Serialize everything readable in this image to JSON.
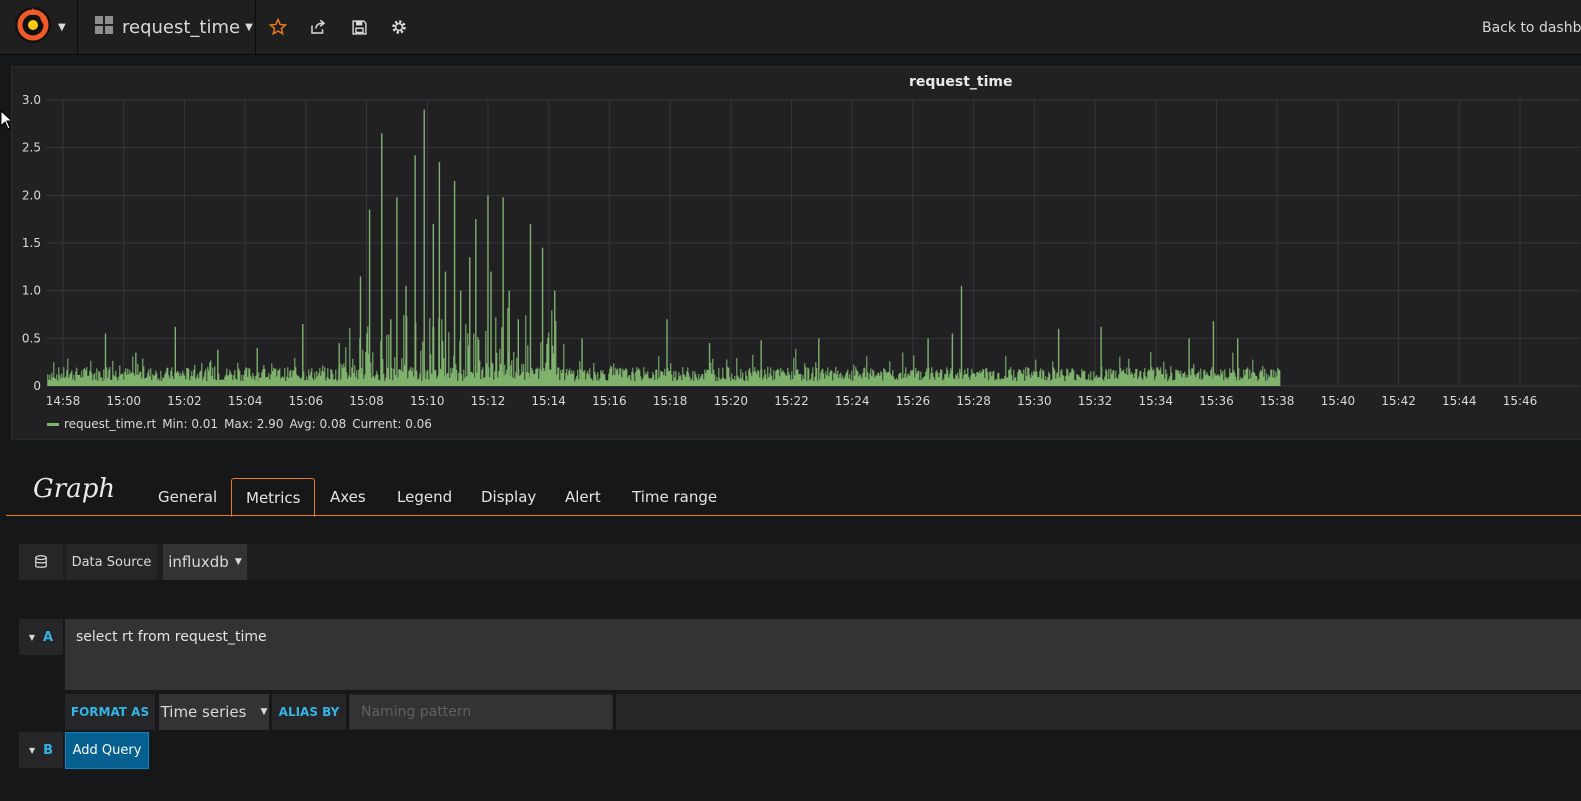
{
  "navbar": {
    "dashboard_title": "request_time",
    "back_label": "Back to dashb"
  },
  "panel": {
    "title": "request_time"
  },
  "chart_data": {
    "type": "bar",
    "title": "request_time",
    "y_ticks": [
      "3.0",
      "2.5",
      "2.0",
      "1.5",
      "1.0",
      "0.5",
      "0"
    ],
    "ylim": [
      0,
      3.0
    ],
    "x_ticks": [
      "14:58",
      "15:00",
      "15:02",
      "15:04",
      "15:06",
      "15:08",
      "15:10",
      "15:12",
      "15:14",
      "15:16",
      "15:18",
      "15:20",
      "15:22",
      "15:24",
      "15:26",
      "15:28",
      "15:30",
      "15:32",
      "15:34",
      "15:36",
      "15:38",
      "15:40",
      "15:42",
      "15:44",
      "15:46"
    ],
    "series": [
      {
        "name": "request_time.rt",
        "color": "#7eb26d",
        "start": "14:57.5",
        "end": "15:38.1",
        "baseline_range": [
          0.05,
          0.2
        ],
        "spikes": [
          [
            "14:59.4",
            0.55
          ],
          [
            "15:00.4",
            0.35
          ],
          [
            "15:01.7",
            0.62
          ],
          [
            "15:03.1",
            0.38
          ],
          [
            "15:04.4",
            0.4
          ],
          [
            "15:05.9",
            0.65
          ],
          [
            "15:07.1",
            0.45
          ],
          [
            "15:07.8",
            1.15
          ],
          [
            "15:08.1",
            1.85
          ],
          [
            "15:08.5",
            1.0
          ],
          [
            "15:08.5",
            2.65
          ],
          [
            "15:08.8",
            0.7
          ],
          [
            "15:09.0",
            1.98
          ],
          [
            "15:09.3",
            1.05
          ],
          [
            "15:09.6",
            2.42
          ],
          [
            "15:09.9",
            2.9
          ],
          [
            "15:10.2",
            1.7
          ],
          [
            "15:10.4",
            2.35
          ],
          [
            "15:10.6",
            1.2
          ],
          [
            "15:10.9",
            2.15
          ],
          [
            "15:11.1",
            1.0
          ],
          [
            "15:11.4",
            1.35
          ],
          [
            "15:11.6",
            1.75
          ],
          [
            "15:12.0",
            2.0
          ],
          [
            "15:12.1",
            1.2
          ],
          [
            "15:12.5",
            1.98
          ],
          [
            "15:12.7",
            1.0
          ],
          [
            "15:13.0",
            0.7
          ],
          [
            "15:13.4",
            1.7
          ],
          [
            "15:13.8",
            1.45
          ],
          [
            "15:14.2",
            1.0
          ],
          [
            "15:15.1",
            0.5
          ],
          [
            "15:17.9",
            0.7
          ],
          [
            "15:19.3",
            0.45
          ],
          [
            "15:21.0",
            0.48
          ],
          [
            "15:22.9",
            0.5
          ],
          [
            "15:26.5",
            0.5
          ],
          [
            "15:27.3",
            0.55
          ],
          [
            "15:27.6",
            1.05
          ],
          [
            "15:30.8",
            0.6
          ],
          [
            "15:32.2",
            0.62
          ],
          [
            "15:35.1",
            0.5
          ],
          [
            "15:35.9",
            0.68
          ],
          [
            "15:36.7",
            0.5
          ]
        ]
      }
    ],
    "legend": {
      "series_name": "request_time.rt",
      "min": "Min: 0.01",
      "max": "Max: 2.90",
      "avg": "Avg: 0.08",
      "current": "Current: 0.06"
    },
    "grid": true
  },
  "editor": {
    "title": "Graph",
    "tabs": [
      "General",
      "Metrics",
      "Axes",
      "Legend",
      "Display",
      "Alert",
      "Time range"
    ],
    "active_tab": "Metrics"
  },
  "datasource": {
    "label": "Data Source",
    "value": "influxdb"
  },
  "queries": {
    "a_letter": "A",
    "a_text": "select rt from request_time",
    "format_label": "FORMAT AS",
    "format_value": "Time series",
    "alias_label": "ALIAS BY",
    "alias_placeholder": "Naming pattern",
    "b_letter": "B",
    "add_query_label": "Add Query"
  },
  "colors": {
    "accent": "#eb7b18",
    "series": "#7eb26d",
    "link_blue": "#33b5e5",
    "button_blue": "#05608f"
  }
}
